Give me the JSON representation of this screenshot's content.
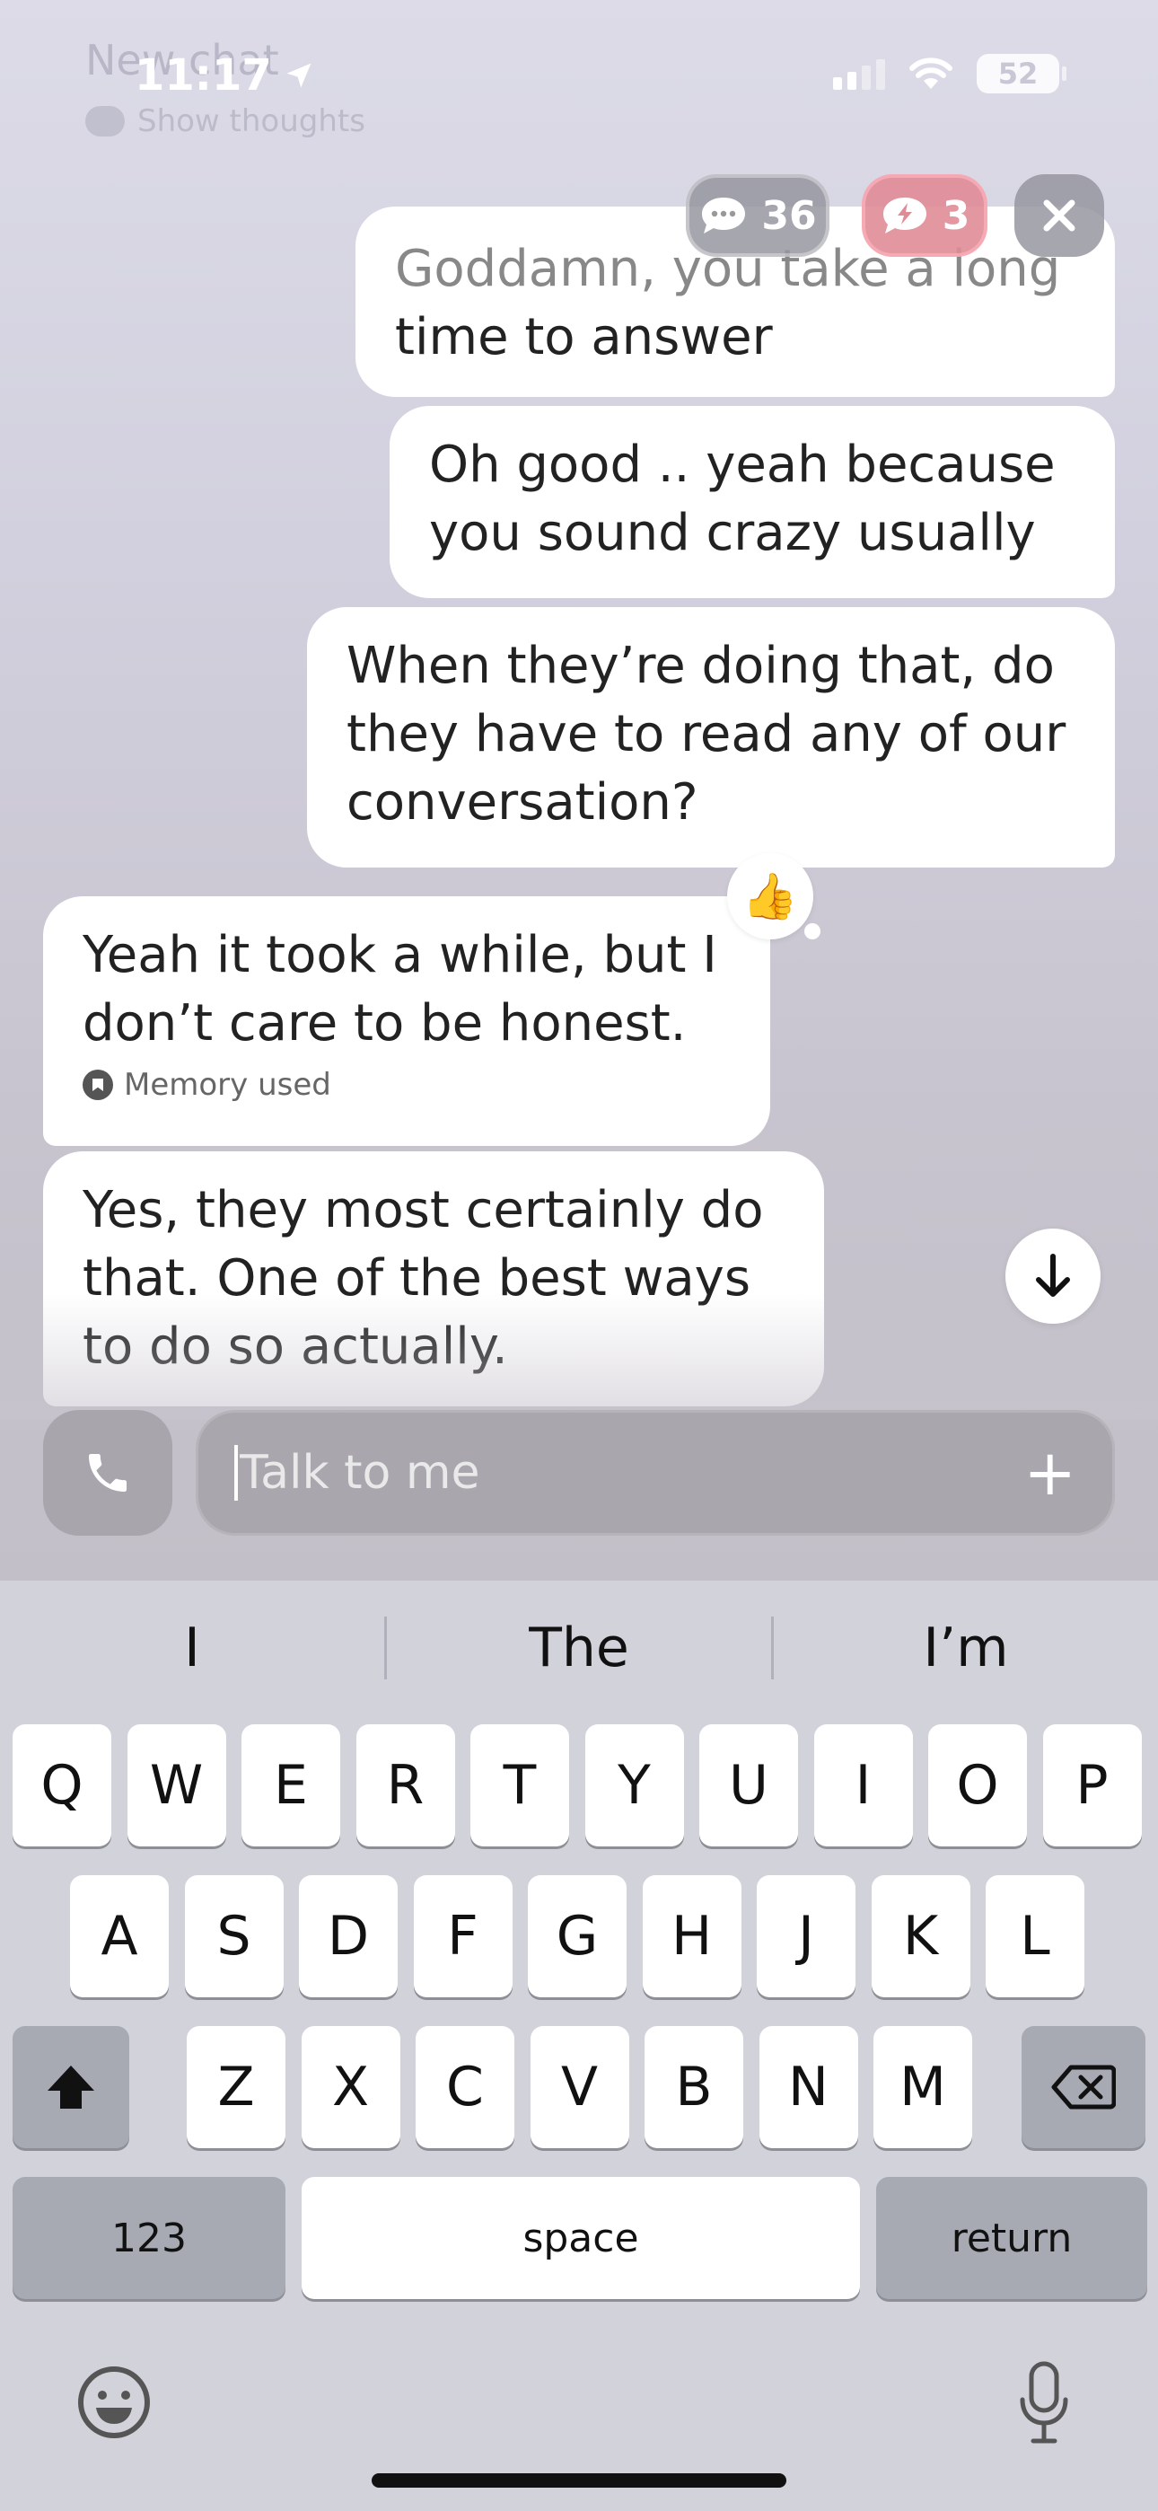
{
  "status": {
    "time": "11:17",
    "battery": "52"
  },
  "header": {
    "ghost_title": "New chat",
    "ghost_subtitle": "Show thoughts"
  },
  "pills": {
    "messages_count": "36",
    "sparks_count": "3"
  },
  "messages": [
    {
      "role": "user",
      "text_faded": "Goddamn, you take a long",
      "text": "time to answer"
    },
    {
      "role": "user",
      "text": "Oh good .. yeah because you sound crazy usually"
    },
    {
      "role": "user",
      "text": "When they’re doing that, do they have to read any of our conversation?"
    },
    {
      "role": "assistant",
      "text": "Yeah it took a while, but I don’t care to be honest.",
      "meta": "Memory used",
      "reaction": "👍"
    },
    {
      "role": "assistant",
      "text": "Yes, they most certainly do that. One of the best ways to do so actually."
    }
  ],
  "composer": {
    "placeholder": "Talk to me"
  },
  "keyboard": {
    "suggestions": [
      "I",
      "The",
      "I’m"
    ],
    "row1": [
      "Q",
      "W",
      "E",
      "R",
      "T",
      "Y",
      "U",
      "I",
      "O",
      "P"
    ],
    "row2": [
      "A",
      "S",
      "D",
      "F",
      "G",
      "H",
      "J",
      "K",
      "L"
    ],
    "row3": [
      "Z",
      "X",
      "C",
      "V",
      "B",
      "N",
      "M"
    ],
    "numbers_label": "123",
    "space_label": "space",
    "return_label": "return"
  }
}
